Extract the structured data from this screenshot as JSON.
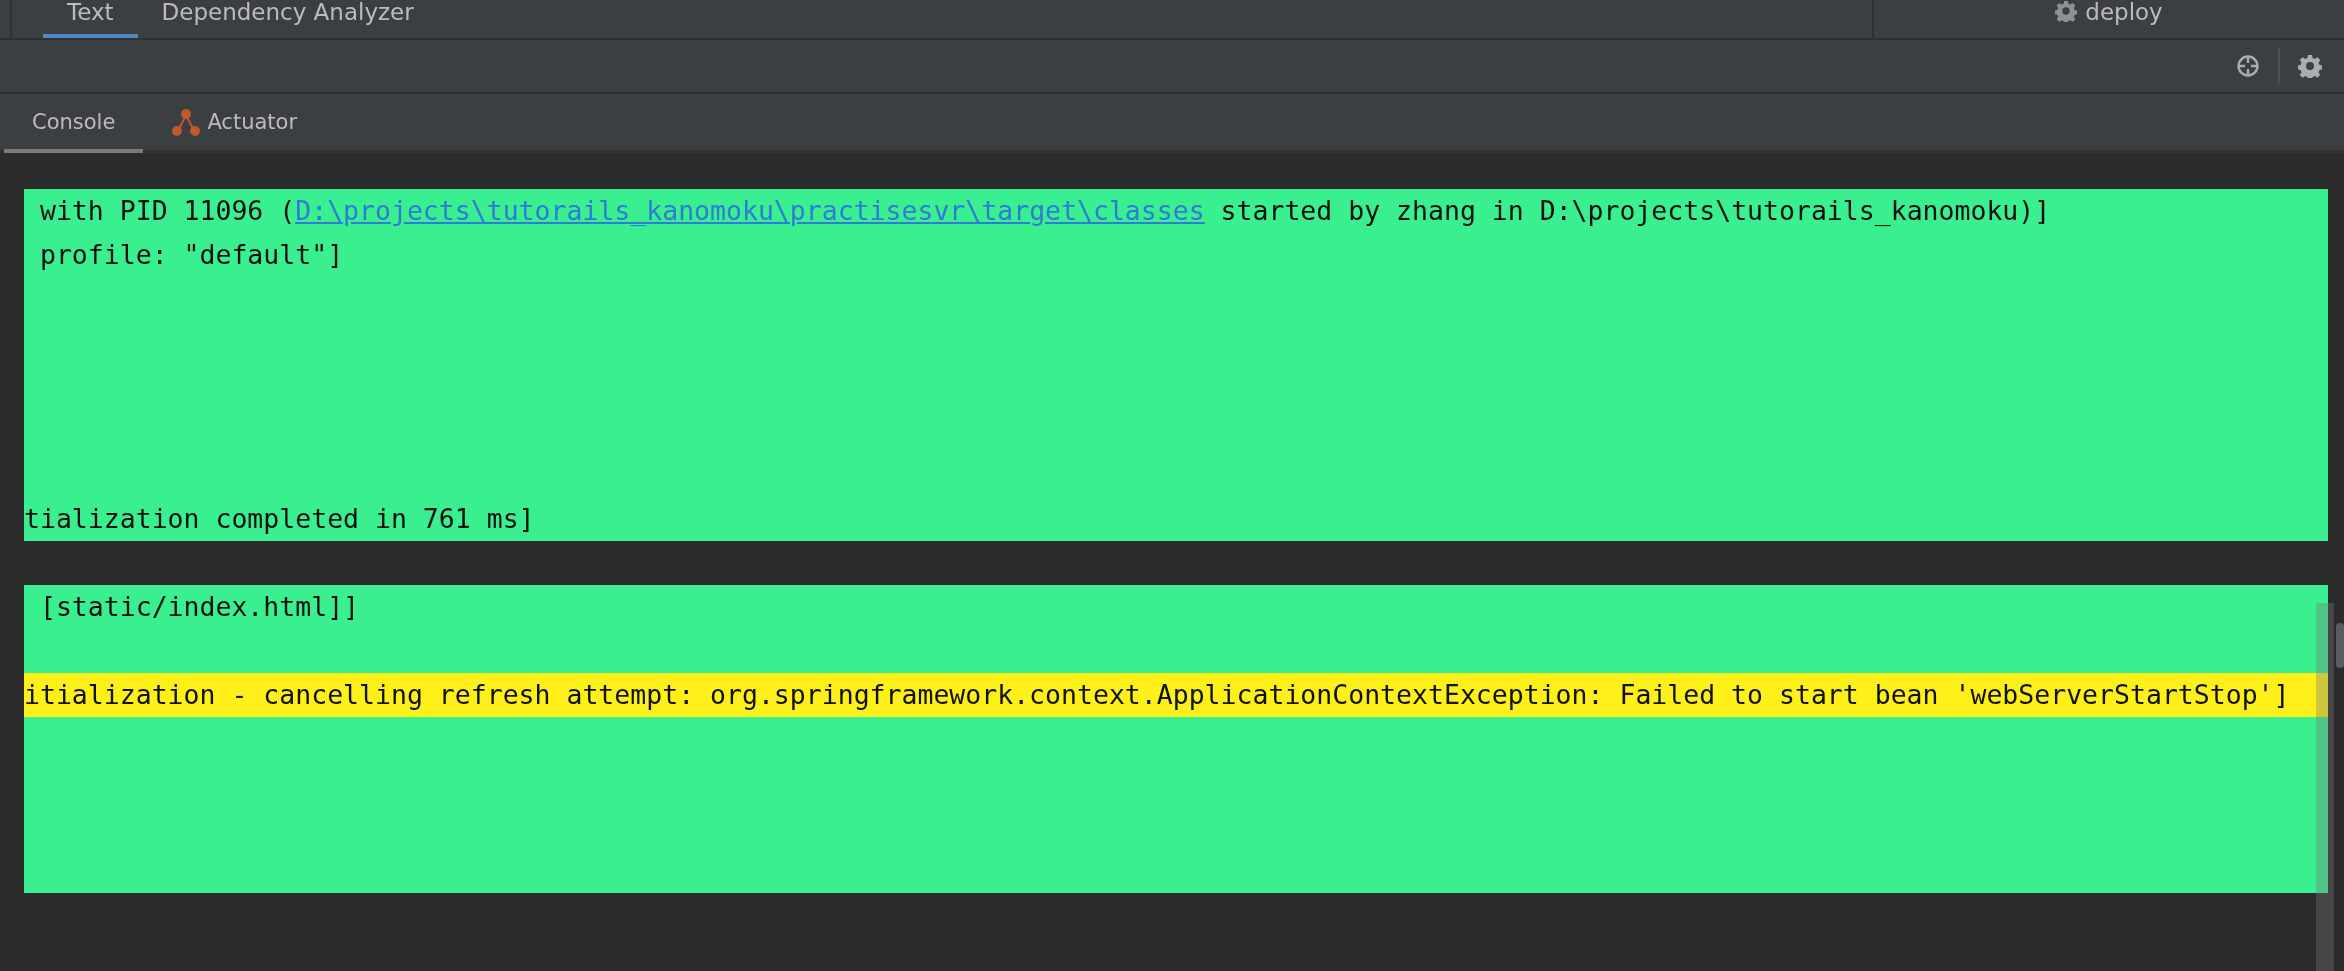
{
  "editor_tabs": [
    {
      "label": "Text",
      "selected": true
    },
    {
      "label": "Dependency Analyzer",
      "selected": false
    }
  ],
  "run_config": {
    "label": "deploy"
  },
  "console_tabs": [
    {
      "label": "Console",
      "selected": true,
      "kind": "plain"
    },
    {
      "label": "Actuator",
      "selected": false,
      "kind": "actuator"
    }
  ],
  "blocks": [
    {
      "lines": [
        {
          "kind": "log",
          "segments": [
            {
              "kind": "text",
              "text": " with PID 11096 ("
            },
            {
              "kind": "link",
              "text": "D:\\projects\\tutorails_kanomoku\\practisesvr\\target\\classes"
            },
            {
              "kind": "text",
              "text": " started by zhang in D:\\projects\\tutorails_kanomoku)]"
            }
          ]
        },
        {
          "kind": "log",
          "segments": [
            {
              "kind": "text",
              "text": " profile: \"default\"]"
            }
          ]
        },
        {
          "kind": "blank"
        },
        {
          "kind": "blank"
        },
        {
          "kind": "blank"
        },
        {
          "kind": "blank"
        },
        {
          "kind": "blank"
        },
        {
          "kind": "log",
          "segments": [
            {
              "kind": "text",
              "text": "tialization completed in 761 ms]"
            }
          ]
        }
      ]
    },
    {
      "lines": [
        {
          "kind": "log",
          "segments": [
            {
              "kind": "text",
              "text": " [static/index.html]]"
            }
          ]
        },
        {
          "kind": "blank"
        },
        {
          "kind": "warning",
          "segments": [
            {
              "kind": "text",
              "text": "itialization - cancelling refresh attempt: org.springframework.context.ApplicationContextException: Failed to start bean 'webServerStartStop']"
            }
          ]
        },
        {
          "kind": "blank"
        },
        {
          "kind": "blank"
        },
        {
          "kind": "blank"
        },
        {
          "kind": "blank"
        }
      ]
    }
  ]
}
